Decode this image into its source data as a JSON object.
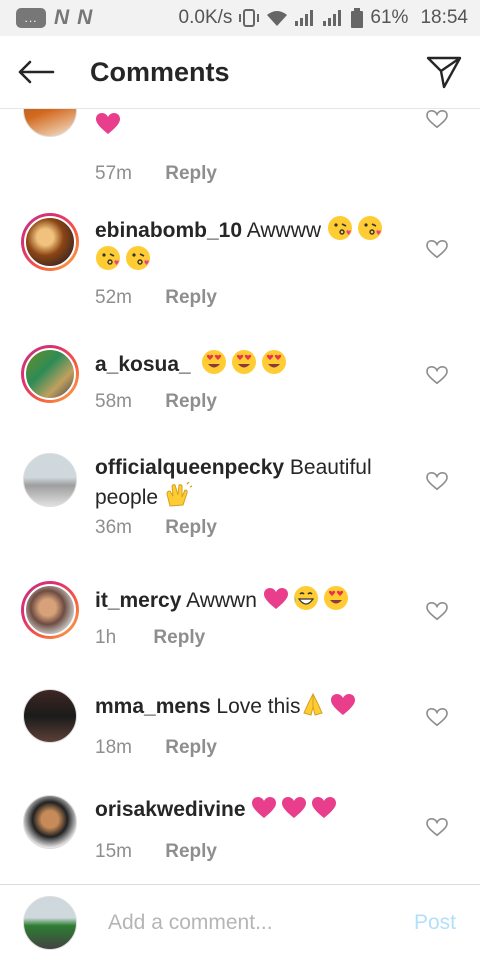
{
  "status_bar": {
    "speed": "0.0K/s",
    "battery": "61%",
    "time": "18:54",
    "badge": "...",
    "carrier_1": "N",
    "carrier_2": "N"
  },
  "header": {
    "title": "Comments"
  },
  "comments": [
    {
      "username": "",
      "text": "",
      "time": "57m",
      "reply_label": "Reply"
    },
    {
      "username": "ebinabomb_10",
      "text": "Awwww",
      "time": "52m",
      "reply_label": "Reply"
    },
    {
      "username": "a_kosua_",
      "text": "",
      "time": "58m",
      "reply_label": "Reply"
    },
    {
      "username": "officialqueenpecky",
      "text": "Beautiful people",
      "time": "36m",
      "reply_label": "Reply"
    },
    {
      "username": "it_mercy",
      "text": "Awwwn",
      "time": "1h",
      "reply_label": "Reply"
    },
    {
      "username": "mma_mens",
      "text": "Love this",
      "time": "18m",
      "reply_label": "Reply"
    },
    {
      "username": "orisakwedivine",
      "text": "",
      "time": "15m",
      "reply_label": "Reply"
    }
  ],
  "comment_input": {
    "placeholder": "Add a comment...",
    "post_label": "Post"
  },
  "colors": {
    "heart_emoji": "#e83e8c",
    "emoji_face": "#ffcc33",
    "post_disabled": "#b2dffc",
    "muted": "#8e8e8e"
  }
}
